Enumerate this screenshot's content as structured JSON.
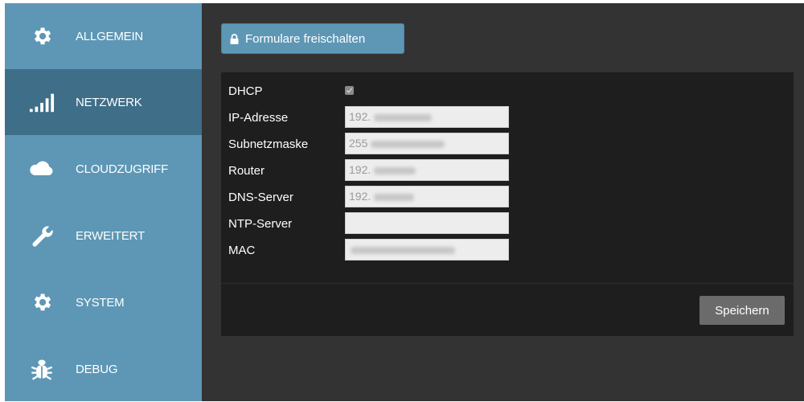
{
  "sidebar": {
    "items": [
      {
        "label": "ALLGEMEIN",
        "icon": "gear-icon"
      },
      {
        "label": "NETZWERK",
        "icon": "signal-bars-icon",
        "active": true
      },
      {
        "label": "CLOUDZUGRIFF",
        "icon": "cloud-icon"
      },
      {
        "label": "ERWEITERT",
        "icon": "wrench-icon"
      },
      {
        "label": "SYSTEM",
        "icon": "gear-icon"
      },
      {
        "label": "DEBUG",
        "icon": "bug-icon"
      }
    ]
  },
  "toolbar": {
    "unlock_label": "Formulare freischalten",
    "unlock_icon": "lock-icon"
  },
  "form": {
    "dhcp_label": "DHCP",
    "dhcp_checked": true,
    "ip_label": "IP-Adresse",
    "ip_value": "192.",
    "subnet_label": "Subnetzmaske",
    "subnet_value": "255",
    "router_label": "Router",
    "router_value": "192.",
    "dns_label": "DNS-Server",
    "dns_value": "192.",
    "ntp_label": "NTP-Server",
    "ntp_value": "",
    "mac_label": "MAC",
    "mac_value": ""
  },
  "footer": {
    "save_label": "Speichern"
  },
  "colors": {
    "sidebar": "#5d97b5",
    "sidebar_active": "#3f6e88",
    "main_bg": "#333333",
    "panel_bg": "#1e1e1e",
    "save_button": "#6b6b6b"
  }
}
